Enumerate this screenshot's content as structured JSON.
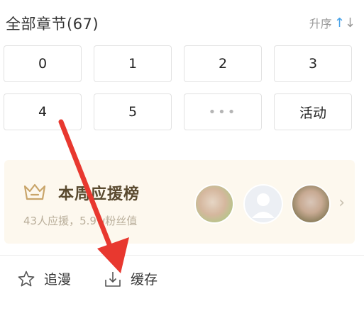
{
  "header": {
    "title": "全部章节(67)",
    "sort_label": "升序"
  },
  "chapters": [
    "0",
    "1",
    "2",
    "3",
    "4",
    "5",
    "•••",
    "活动"
  ],
  "fan_board": {
    "title": "本周应援榜",
    "subtitle": "43人应援，5.9w粉丝值"
  },
  "actions": {
    "follow": "追漫",
    "cache": "缓存"
  },
  "colors": {
    "accent_blue": "#4aa3e8",
    "card_bg": "#fdf8ee",
    "arrow_red": "#e8382f"
  }
}
